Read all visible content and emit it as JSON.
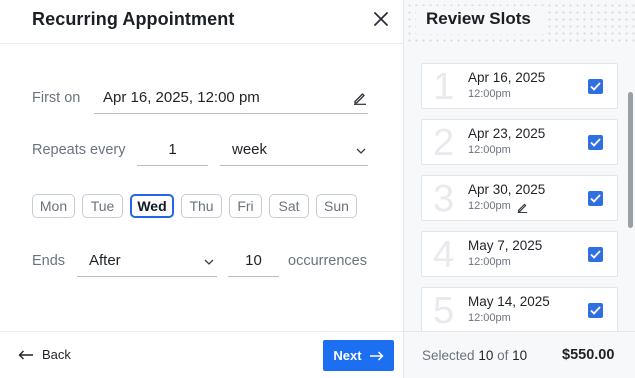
{
  "left": {
    "title": "Recurring Appointment",
    "first_on": {
      "label": "First on",
      "value": "Apr 16, 2025, 12:00 pm"
    },
    "repeats": {
      "label": "Repeats every",
      "count": "1",
      "unit": "week"
    },
    "days": [
      {
        "label": "Mon",
        "selected": false
      },
      {
        "label": "Tue",
        "selected": false
      },
      {
        "label": "Wed",
        "selected": true
      },
      {
        "label": "Thu",
        "selected": false
      },
      {
        "label": "Fri",
        "selected": false
      },
      {
        "label": "Sat",
        "selected": false
      },
      {
        "label": "Sun",
        "selected": false
      }
    ],
    "ends": {
      "label": "Ends",
      "mode": "After",
      "count": "10",
      "suffix": "occurrences"
    },
    "back_label": "Back",
    "next_label": "Next"
  },
  "right": {
    "title": "Review Slots",
    "slots": [
      {
        "num": "1",
        "date": "Apr 16, 2025",
        "time": "12:00pm",
        "checked": true
      },
      {
        "num": "2",
        "date": "Apr 23, 2025",
        "time": "12:00pm",
        "checked": true
      },
      {
        "num": "3",
        "date": "Apr 30, 2025",
        "time": "12:00pm",
        "checked": true
      },
      {
        "num": "4",
        "date": "May 7, 2025",
        "time": "12:00pm",
        "checked": true
      },
      {
        "num": "5",
        "date": "May 14, 2025",
        "time": "12:00pm",
        "checked": true
      }
    ],
    "selected_prefix": "Selected",
    "selected_count": "10",
    "selected_of": "of",
    "total_count": "10",
    "total_price": "$550.00"
  },
  "colors": {
    "accent": "#1d6ff2",
    "checkbox": "#2f6fe0"
  }
}
